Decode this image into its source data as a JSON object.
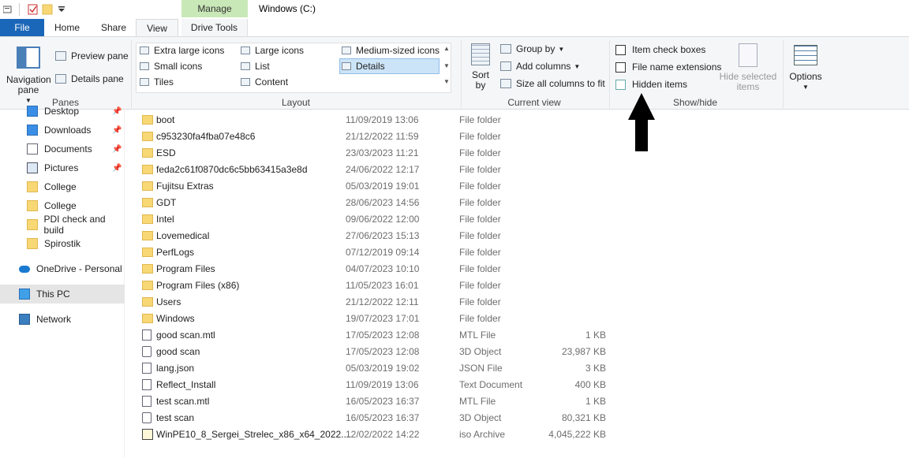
{
  "window": {
    "title": "Windows (C:)",
    "context_tab": "Manage"
  },
  "tabs": [
    "File",
    "Home",
    "Share",
    "View",
    "Drive Tools"
  ],
  "ribbon": {
    "panes": {
      "navigation_pane": "Navigation pane",
      "preview_pane": "Preview pane",
      "details_pane": "Details pane",
      "label": "Panes"
    },
    "layout": {
      "items": [
        "Extra large icons",
        "Large icons",
        "Medium-sized icons",
        "Small icons",
        "List",
        "Details",
        "Tiles",
        "Content"
      ],
      "selected": "Details",
      "label": "Layout"
    },
    "current_view": {
      "sort_by": "Sort by",
      "group_by": "Group by",
      "add_columns": "Add columns",
      "size_all_columns": "Size all columns to fit",
      "label": "Current view"
    },
    "show_hide": {
      "item_check_boxes": "Item check boxes",
      "file_name_extensions": "File name extensions",
      "hidden_items": "Hidden items",
      "hide_selected_items": "Hide selected items",
      "label": "Show/hide"
    },
    "options": "Options"
  },
  "sidebar": {
    "items": [
      {
        "label": "Desktop",
        "icon": "desktop-icon",
        "pinned": true
      },
      {
        "label": "Downloads",
        "icon": "downloads-icon",
        "pinned": true
      },
      {
        "label": "Documents",
        "icon": "documents-icon",
        "pinned": true
      },
      {
        "label": "Pictures",
        "icon": "pictures-icon",
        "pinned": true
      },
      {
        "label": "College",
        "icon": "folder-icon",
        "pinned": false
      },
      {
        "label": "College",
        "icon": "folder-icon",
        "pinned": false
      },
      {
        "label": "PDI check and build",
        "icon": "folder-icon",
        "pinned": false
      },
      {
        "label": "Spirostik",
        "icon": "folder-icon",
        "pinned": false
      },
      {
        "label": "OneDrive - Personal",
        "icon": "onedrive-icon",
        "pinned": false
      },
      {
        "label": "This PC",
        "icon": "this-pc-icon",
        "pinned": false,
        "selected": true
      },
      {
        "label": "Network",
        "icon": "network-icon",
        "pinned": false
      }
    ]
  },
  "files": [
    {
      "name": "boot",
      "date": "11/09/2019 13:06",
      "type": "File folder",
      "size": "",
      "icon": "folder"
    },
    {
      "name": "c953230fa4fba07e48c6",
      "date": "21/12/2022 11:59",
      "type": "File folder",
      "size": "",
      "icon": "folder"
    },
    {
      "name": "ESD",
      "date": "23/03/2023 11:21",
      "type": "File folder",
      "size": "",
      "icon": "folder"
    },
    {
      "name": "feda2c61f0870dc6c5bb63415a3e8d",
      "date": "24/06/2022 12:17",
      "type": "File folder",
      "size": "",
      "icon": "folder"
    },
    {
      "name": "Fujitsu Extras",
      "date": "05/03/2019 19:01",
      "type": "File folder",
      "size": "",
      "icon": "folder"
    },
    {
      "name": "GDT",
      "date": "28/06/2023 14:56",
      "type": "File folder",
      "size": "",
      "icon": "folder"
    },
    {
      "name": "Intel",
      "date": "09/06/2022 12:00",
      "type": "File folder",
      "size": "",
      "icon": "folder"
    },
    {
      "name": "Lovemedical",
      "date": "27/06/2023 15:13",
      "type": "File folder",
      "size": "",
      "icon": "folder"
    },
    {
      "name": "PerfLogs",
      "date": "07/12/2019 09:14",
      "type": "File folder",
      "size": "",
      "icon": "folder"
    },
    {
      "name": "Program Files",
      "date": "04/07/2023 10:10",
      "type": "File folder",
      "size": "",
      "icon": "folder"
    },
    {
      "name": "Program Files (x86)",
      "date": "11/05/2023 16:01",
      "type": "File folder",
      "size": "",
      "icon": "folder"
    },
    {
      "name": "Users",
      "date": "21/12/2022 12:11",
      "type": "File folder",
      "size": "",
      "icon": "folder"
    },
    {
      "name": "Windows",
      "date": "19/07/2023 17:01",
      "type": "File folder",
      "size": "",
      "icon": "folder"
    },
    {
      "name": "good scan.mtl",
      "date": "17/05/2023 12:08",
      "type": "MTL File",
      "size": "1 KB",
      "icon": "file"
    },
    {
      "name": "good scan",
      "date": "17/05/2023 12:08",
      "type": "3D Object",
      "size": "23,987 KB",
      "icon": "obj"
    },
    {
      "name": "lang.json",
      "date": "05/03/2019 19:02",
      "type": "JSON File",
      "size": "3 KB",
      "icon": "file"
    },
    {
      "name": "Reflect_Install",
      "date": "11/09/2019 13:06",
      "type": "Text Document",
      "size": "400 KB",
      "icon": "file"
    },
    {
      "name": "test scan.mtl",
      "date": "16/05/2023 16:37",
      "type": "MTL File",
      "size": "1 KB",
      "icon": "file"
    },
    {
      "name": "test scan",
      "date": "16/05/2023 16:37",
      "type": "3D Object",
      "size": "80,321 KB",
      "icon": "obj"
    },
    {
      "name": "WinPE10_8_Sergei_Strelec_x86_x64_2022....",
      "date": "12/02/2022 14:22",
      "type": "iso Archive",
      "size": "4,045,222 KB",
      "icon": "iso"
    }
  ],
  "colors": {
    "file_tab": "#1a66b8",
    "manage_tab": "#c9e8b8",
    "selection": "#cce4f7"
  }
}
